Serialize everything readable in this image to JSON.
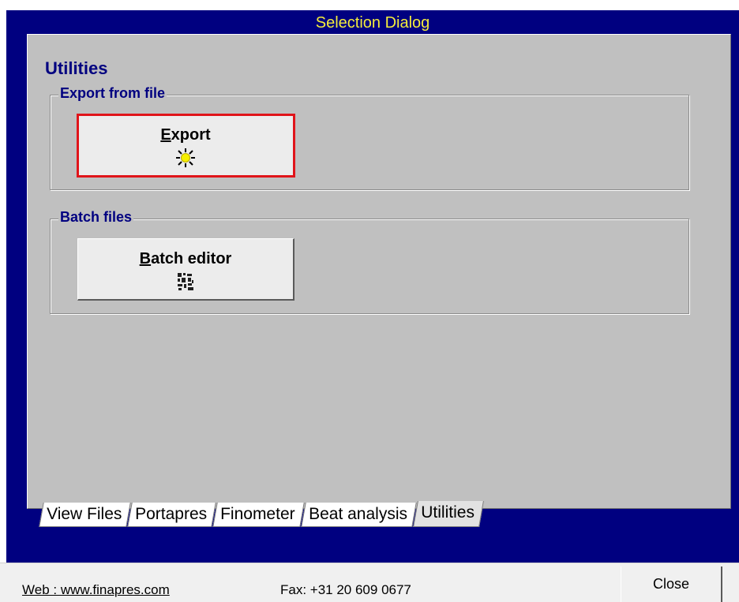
{
  "window": {
    "title": "Selection Dialog"
  },
  "page": {
    "title": "Utilities"
  },
  "groups": [
    {
      "label": "Export from file",
      "button": {
        "label": "Export",
        "icon": "sun-icon",
        "highlighted": true
      }
    },
    {
      "label": "Batch files",
      "button": {
        "label": "Batch editor",
        "icon": "batch-grid-icon",
        "highlighted": false
      }
    }
  ],
  "tabs": [
    {
      "label": "View Files"
    },
    {
      "label": "Portapres"
    },
    {
      "label": "Finometer"
    },
    {
      "label": "Beat analysis"
    },
    {
      "label": "Utilities",
      "active": true
    }
  ],
  "statusbar": {
    "web": "Web : www.finapres.com",
    "fax": "Fax: +31 20 609 0677",
    "close_label": "Close"
  },
  "colors": {
    "window_frame": "#000080",
    "title_text": "#f4ec3c",
    "panel": "#c0c0c0",
    "highlight": "#e0141a"
  }
}
